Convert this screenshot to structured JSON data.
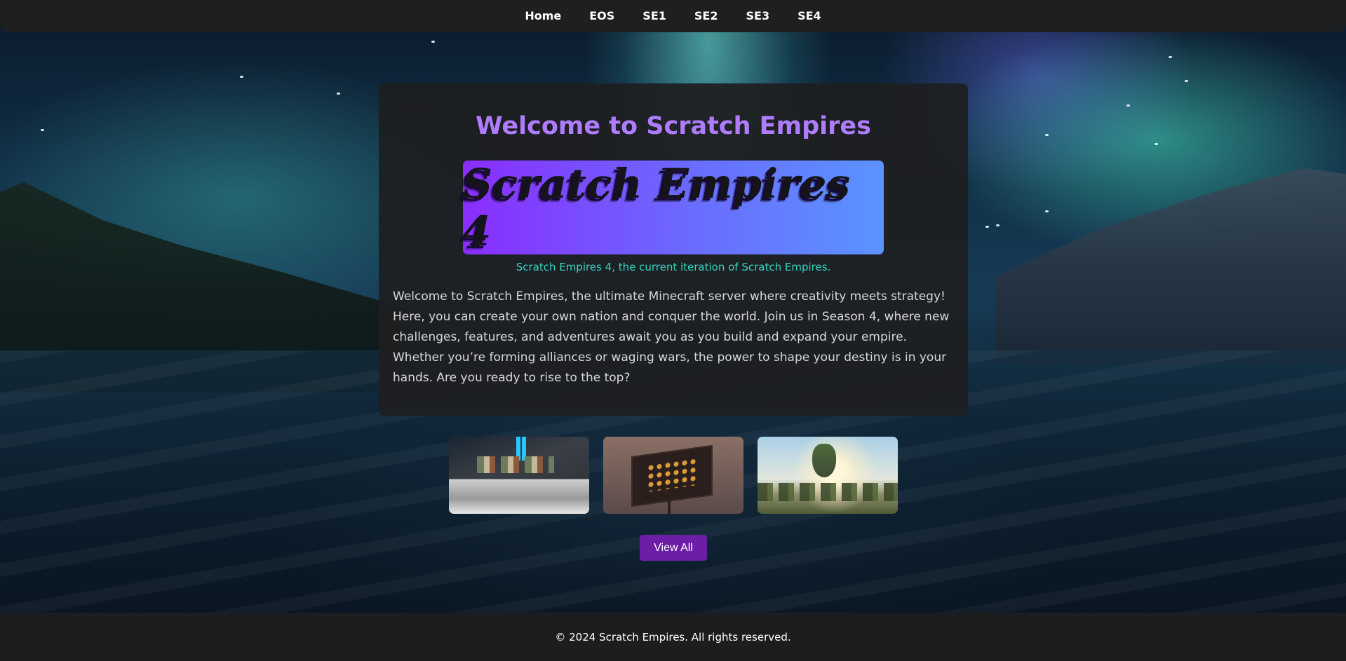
{
  "nav": {
    "items": [
      {
        "label": "Home"
      },
      {
        "label": "EOS"
      },
      {
        "label": "SE1"
      },
      {
        "label": "SE2"
      },
      {
        "label": "SE3"
      },
      {
        "label": "SE4"
      }
    ]
  },
  "main": {
    "title": "Welcome to Scratch Empires",
    "banner_text": "Scratch Empires 4",
    "banner_caption": "Scratch Empires 4, the current iteration of Scratch Empires.",
    "intro": "Welcome to Scratch Empires, the ultimate Minecraft server where creativity meets strategy! Here, you can create your own nation and conquer the world. Join us in Season 4, where new challenges, features, and adventures await you as you build and expand your empire. Whether you’re forming alliances or waging wars, the power to shape your destiny is in your hands. Are you ready to rise to the top?"
  },
  "gallery": {
    "view_all_label": "View All"
  },
  "footer": {
    "text": "© 2024 Scratch Empires. All rights reserved."
  },
  "colors": {
    "accent": "#b07cff",
    "caption": "#35d6c2",
    "button": "#6c1fa6",
    "banner_start": "#8a2dff",
    "banner_end": "#5b93ff"
  }
}
